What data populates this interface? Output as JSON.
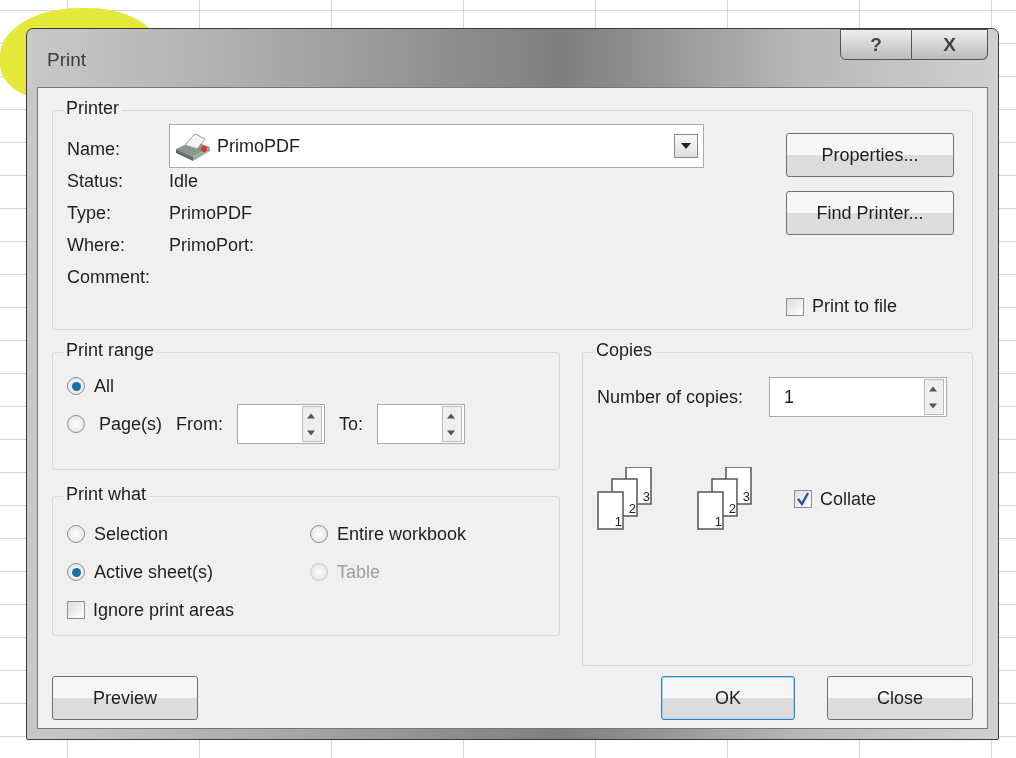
{
  "window": {
    "title": "Print",
    "buttons": [
      {
        "kind": "help",
        "label": "?"
      },
      {
        "kind": "close",
        "label": "X"
      }
    ]
  },
  "printer": {
    "legend": "Printer",
    "name_label": "Name:",
    "name_value": "PrimoPDF",
    "fields": [
      {
        "label": "Status:",
        "value": "Idle"
      },
      {
        "label": "Type:",
        "value": "PrimoPDF"
      },
      {
        "label": "Where:",
        "value": "PrimoPort:"
      },
      {
        "label": "Comment:"
      }
    ],
    "buttons": [
      "Properties...",
      "Find Printer..."
    ],
    "print_to_file": {
      "label": "Print to file",
      "checked": false
    }
  },
  "print_range": {
    "legend": "Print range",
    "options": [
      {
        "label": "All",
        "selected": true
      },
      {
        "label": "Page(s)",
        "selected": false
      }
    ],
    "from_label": "From:",
    "to_label": "To:"
  },
  "print_what": {
    "legend": "Print what",
    "options": [
      {
        "label": "Selection",
        "selected": false,
        "disabled": false
      },
      {
        "label": "Entire workbook",
        "selected": false,
        "disabled": false
      },
      {
        "label": "Active sheet(s)",
        "selected": true,
        "disabled": false
      },
      {
        "label": "Table",
        "selected": false,
        "disabled": true
      }
    ],
    "ignore_print_areas": {
      "label": "Ignore print areas",
      "checked": false
    }
  },
  "copies": {
    "legend": "Copies",
    "count_label": "Number of copies:",
    "count_value": "1",
    "stacks": [
      {
        "pages": [
          "1",
          "2",
          "3"
        ]
      },
      {
        "pages": [
          "1",
          "2",
          "3"
        ]
      }
    ],
    "collate": {
      "label": "Collate",
      "checked": true
    }
  },
  "footer": [
    {
      "label": "Preview",
      "default": false
    },
    {
      "label": "OK",
      "default": true
    },
    {
      "label": "Close",
      "default": false
    }
  ]
}
